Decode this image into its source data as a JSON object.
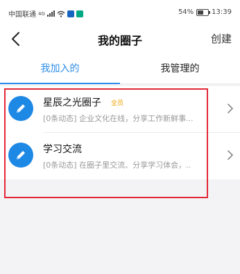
{
  "status_bar": {
    "carrier": "中国联通",
    "network": "4G",
    "battery": "54%",
    "time": "13:39"
  },
  "header": {
    "title": "我的圈子",
    "create_label": "创建"
  },
  "tabs": [
    {
      "label": "我加入的",
      "active": true
    },
    {
      "label": "我管理的",
      "active": false
    }
  ],
  "circles": [
    {
      "name": "星辰之光圈子",
      "badge": "全员",
      "description": "[0条动态] 企业文化在线，分享工作新鲜事..."
    },
    {
      "name": "学习交流",
      "badge": "",
      "description": "[0条动态] 在圈子里交流、分享学习体会，.."
    }
  ],
  "colors": {
    "accent": "#2b8ce9",
    "avatar": "#1e88e5",
    "badge": "#f0a000",
    "highlight": "#e32636"
  },
  "icons": {
    "back": "chevron-left-icon",
    "row_arrow": "chevron-right-icon",
    "avatar": "pencil-icon"
  }
}
